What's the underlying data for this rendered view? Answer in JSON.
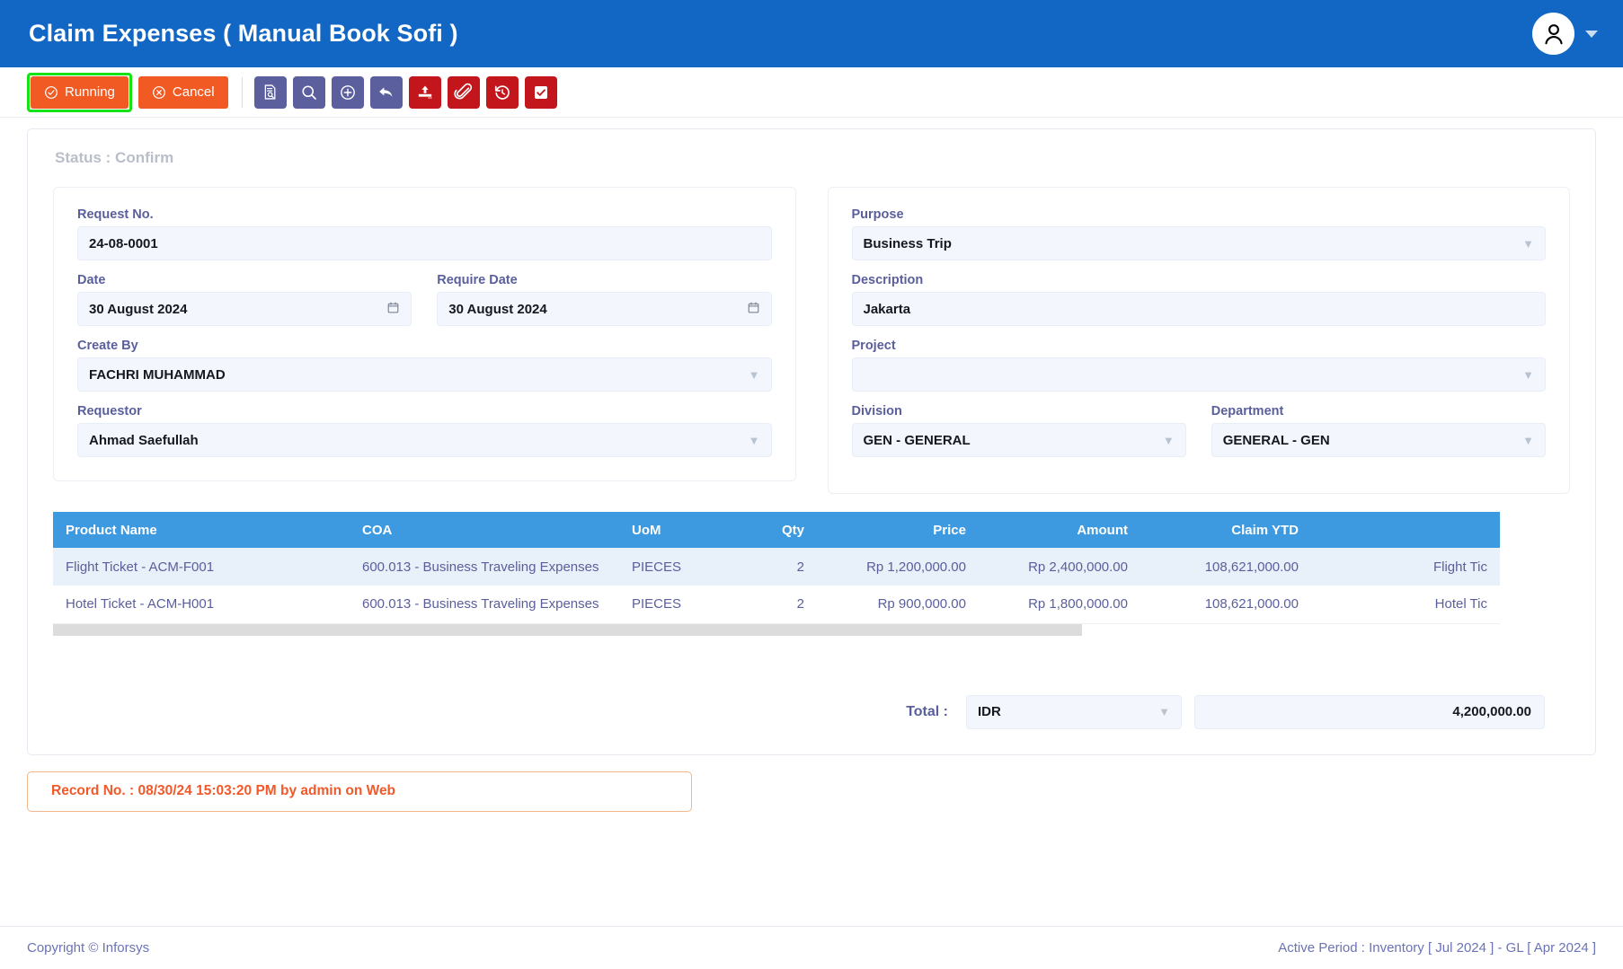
{
  "topbar": {
    "title": "Claim Expenses ( Manual Book Sofi )",
    "avatar_icon": "user-icon",
    "caret_icon": "caret-down-icon"
  },
  "toolbar": {
    "status_button": {
      "label": "Running",
      "icon": "check-circle-icon",
      "color": "#f15a22",
      "highlight_color": "#16e316"
    },
    "cancel_button": {
      "label": "Cancel",
      "icon": "x-circle-icon",
      "color": "#f15a22"
    },
    "icon_buttons": [
      {
        "name": "document-search-icon",
        "color": "#5c5f9e"
      },
      {
        "name": "search-icon",
        "color": "#5c5f9e"
      },
      {
        "name": "plus-circle-icon",
        "color": "#5c5f9e"
      },
      {
        "name": "undo-arrow-icon",
        "color": "#5c5f9e"
      },
      {
        "name": "upload-icon",
        "color": "#c2161c"
      },
      {
        "name": "paperclip-icon",
        "color": "#c2161c"
      },
      {
        "name": "history-icon",
        "color": "#c2161c"
      },
      {
        "name": "checkbox-icon",
        "color": "#c2161c"
      }
    ]
  },
  "status": {
    "text": "Status : Confirm"
  },
  "left_panel": {
    "request_no": {
      "label": "Request No.",
      "value": "24-08-0001"
    },
    "date": {
      "label": "Date",
      "value": "30 August 2024",
      "icon": "calendar-icon"
    },
    "require_date": {
      "label": "Require Date",
      "value": "30 August 2024",
      "icon": "calendar-icon"
    },
    "create_by": {
      "label": "Create By",
      "value": "FACHRI MUHAMMAD",
      "icon": "chevron-down-icon"
    },
    "requestor": {
      "label": "Requestor",
      "value": "Ahmad Saefullah",
      "icon": "chevron-down-icon"
    }
  },
  "right_panel": {
    "purpose": {
      "label": "Purpose",
      "value": "Business Trip",
      "icon": "chevron-down-icon"
    },
    "description": {
      "label": "Description",
      "value": "Jakarta"
    },
    "project": {
      "label": "Project",
      "value": "",
      "icon": "chevron-down-icon"
    },
    "division": {
      "label": "Division",
      "value": "GEN - GENERAL",
      "icon": "chevron-down-icon"
    },
    "department": {
      "label": "Department",
      "value": "GENERAL - GEN",
      "icon": "chevron-down-icon"
    }
  },
  "table": {
    "header_color": "#3d99e0",
    "columns": [
      "Product Name",
      "COA",
      "UoM",
      "Qty",
      "Price",
      "Amount",
      "Claim YTD",
      ""
    ],
    "rows": [
      {
        "product_name": "Flight Ticket - ACM-F001",
        "coa": "600.013 - Business Traveling Expenses",
        "uom": "PIECES",
        "qty": "2",
        "price": "Rp 1,200,000.00",
        "amount": "Rp 2,400,000.00",
        "claim_ytd": "108,621,000.00",
        "desc": "Flight Tic"
      },
      {
        "product_name": "Hotel Ticket - ACM-H001",
        "coa": "600.013 - Business Traveling Expenses",
        "uom": "PIECES",
        "qty": "2",
        "price": "Rp 900,000.00",
        "amount": "Rp 1,800,000.00",
        "claim_ytd": "108,621,000.00",
        "desc": "Hotel Tic"
      }
    ]
  },
  "total": {
    "label": "Total  :",
    "currency": "IDR",
    "currency_icon": "chevron-down-icon",
    "amount": "4,200,000.00"
  },
  "record_note": {
    "text": "Record No. : 08/30/24 15:03:20 PM by admin on Web",
    "color": "#f1592a"
  },
  "footer": {
    "copyright": "Copyright © Inforsys",
    "active_period": "Active Period  :  Inventory [ Jul 2024 ]  -  GL [ Apr 2024 ]"
  }
}
